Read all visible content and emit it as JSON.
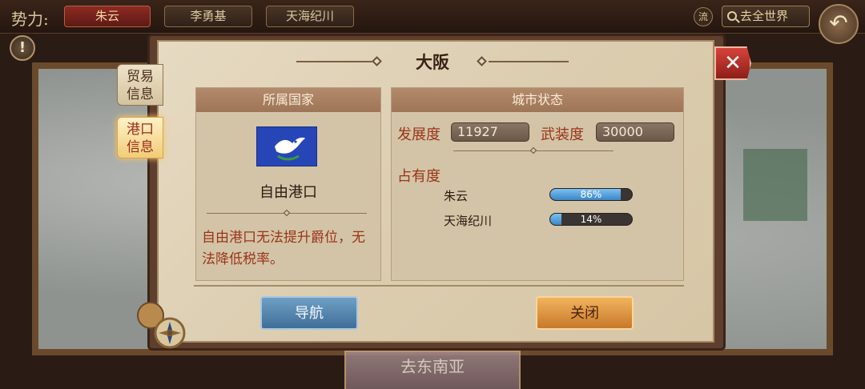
{
  "topbar": {
    "faction_label": "势力:",
    "factions": [
      "朱云",
      "李勇基",
      "天海纪川"
    ],
    "flow_label": "流",
    "world_label": "去全世界"
  },
  "map": {
    "bottom_label": "去东南亚"
  },
  "side_tabs": [
    {
      "label": "贸易信息",
      "active": false
    },
    {
      "label": "港口信息",
      "active": true
    }
  ],
  "dialog": {
    "title": "大阪",
    "country_panel": {
      "header": "所属国家",
      "port_name": "自由港口",
      "note": "自由港口无法提升爵位，无法降低税率。"
    },
    "city_panel": {
      "header": "城市状态",
      "development_label": "发展度",
      "development_value": "11927",
      "armament_label": "武装度",
      "armament_value": "30000",
      "occupancy_label": "占有度",
      "occupancy": [
        {
          "name": "朱云",
          "percent": 86,
          "text": "86%"
        },
        {
          "name": "天海纪川",
          "percent": 14,
          "text": "14%"
        }
      ]
    },
    "buttons": {
      "navigate": "导航",
      "close": "关闭"
    }
  },
  "colors": {
    "accent_red": "#9b3419",
    "bar_blue": "#3a86c8",
    "nav_button": "#4f80a8",
    "close_button": "#e09a45"
  },
  "icons": [
    "alert-icon",
    "back-arrow-icon",
    "search-icon",
    "close-icon",
    "dove-flag-icon",
    "compass-icon"
  ]
}
